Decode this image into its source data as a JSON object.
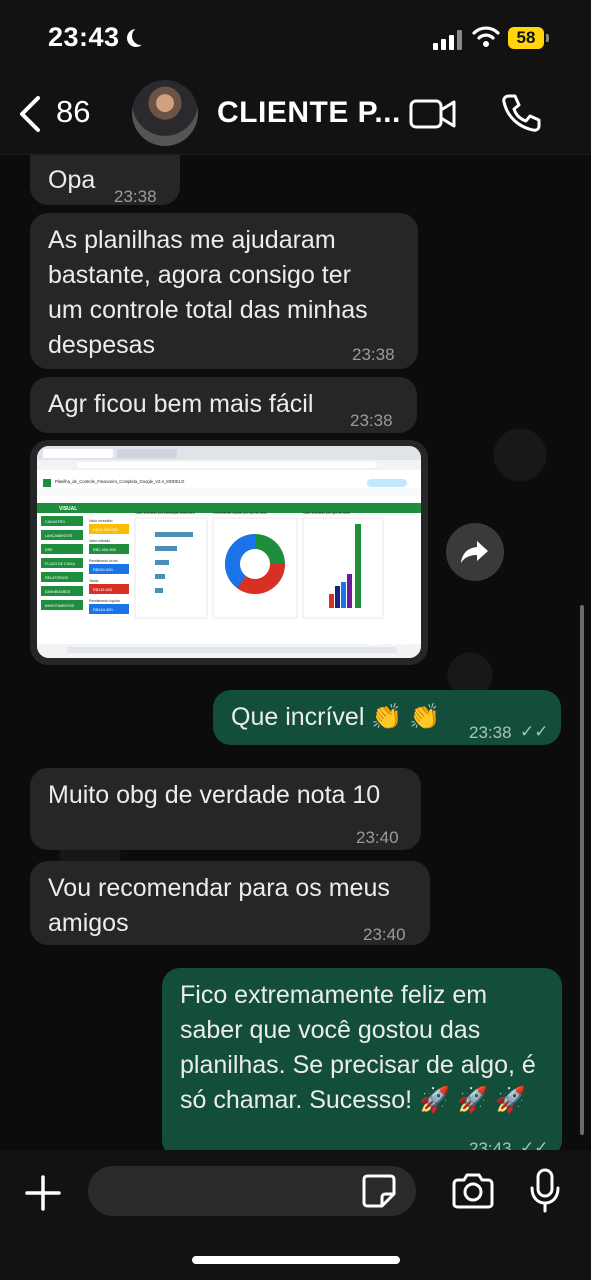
{
  "status": {
    "time": "23:43",
    "battery": "58"
  },
  "header": {
    "back_count": "86",
    "contact_name": "CLIENTE P..."
  },
  "messages": [
    {
      "text": "Opa",
      "time": "23:38"
    },
    {
      "text": "As planilhas me ajudaram bastante, agora consigo ter um controle total das minhas despesas",
      "time": "23:38"
    },
    {
      "text": "Agr ficou bem mais fácil",
      "time": "23:38"
    },
    {
      "image_time": "23:38"
    },
    {
      "text": "Que incrível 👏 👏",
      "time": "23:38"
    },
    {
      "text": "Muito obg de verdade nota 10",
      "time": "23:40"
    },
    {
      "text": "Vou recomendar para os meus amigos",
      "time": "23:40"
    },
    {
      "text": "Fico extremamente feliz em saber que você gostou das planilhas. Se precisar de algo, é só chamar. Sucesso! 🚀 🚀 🚀",
      "time": "23:43"
    }
  ],
  "spreadsheet": {
    "title": "Planilha_de_Controle_Financeiro_Completa_Google_V3.4_MODELO",
    "menu": [
      "Arquivo",
      "Editar",
      "Ver",
      "Inserir",
      "Formatar",
      "Dados",
      "Ferramentas",
      "Extensões",
      "Ajuda"
    ],
    "brand": "VISUAL",
    "nav": [
      "CADASTRO",
      "LANÇAMENTOS",
      "DRE",
      "FLUXO DE CAIXA",
      "RELATÓRIOS",
      "DASHBOARDS",
      "INVESTIMENTOS"
    ],
    "cards": [
      {
        "label": "Valor Investido",
        "value": "R$12.850.000"
      },
      {
        "label": "Valor retirado",
        "value": "R$1.460.000"
      },
      {
        "label": "Rendimento bruto",
        "value": "R$260.000"
      },
      {
        "label": "Taxas",
        "value": "R$115.600"
      },
      {
        "label": "Rendimento líquido",
        "value": "R$144.400"
      }
    ],
    "chart_titles": [
      "Valor investido por instituição financeira",
      "Rendimento líquido por tipo de ativo",
      "Valor investido por tipo de ativo"
    ]
  },
  "input": {
    "placeholder": ""
  }
}
